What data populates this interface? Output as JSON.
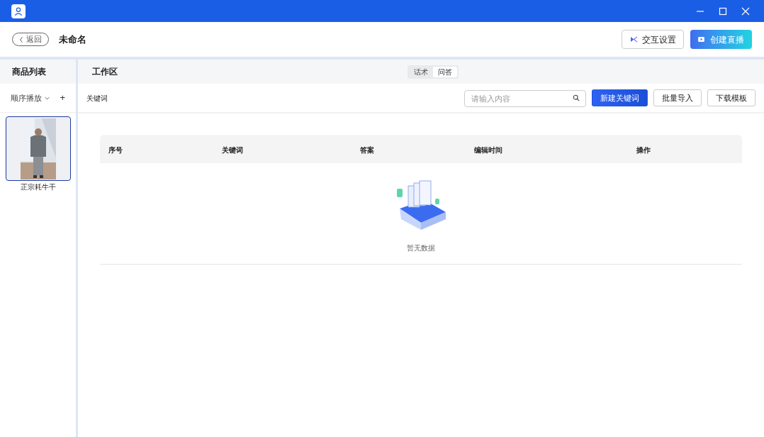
{
  "header": {
    "back": "返回",
    "title": "未命名",
    "interact_button": "交互设置",
    "create_button": "创建直播"
  },
  "sidebar": {
    "title": "商品列表",
    "order": "顺序播放",
    "add": "+",
    "products": [
      {
        "name": "正宗耗牛干",
        "selected": true
      }
    ]
  },
  "workspace": {
    "title": "工作区",
    "tabs": [
      {
        "label": "话术",
        "selected": false
      },
      {
        "label": "问答",
        "selected": true
      }
    ]
  },
  "toolbar": {
    "label": "关键词",
    "search": {
      "placeholder": "请输入内容"
    },
    "buttons": [
      {
        "label": "新建关键词",
        "kind": "primary"
      },
      {
        "label": "批量导入",
        "kind": "default"
      },
      {
        "label": "下载模板",
        "kind": "default"
      }
    ]
  },
  "table": {
    "columns": [
      "序号",
      "关键词",
      "答案",
      "编辑时间",
      "操作"
    ],
    "empty": "暂无数据"
  }
}
